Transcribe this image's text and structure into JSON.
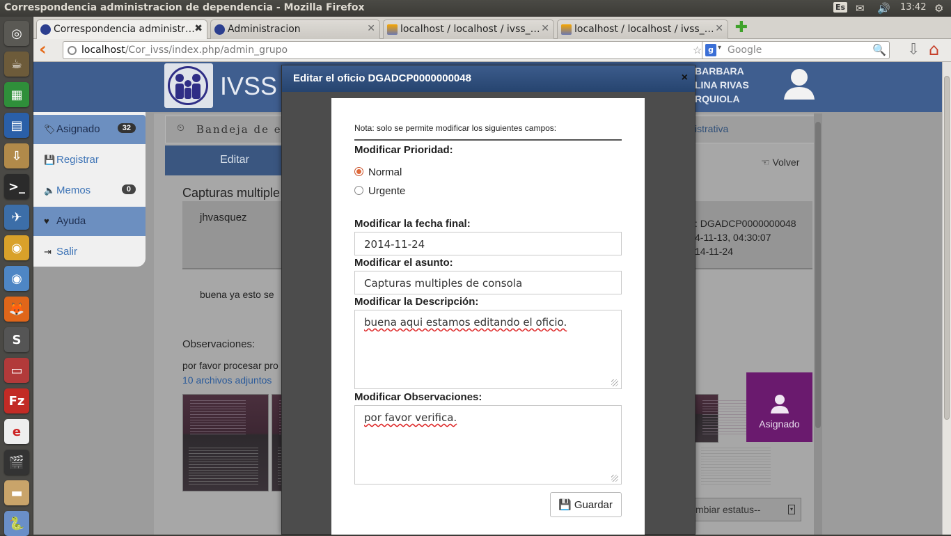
{
  "os_panel": {
    "window_title": "Correspondencia administracion de dependencia - Mozilla Firefox",
    "keyboard_layout": "Es",
    "time": "13:42"
  },
  "browser": {
    "tabs": [
      {
        "label": "Correspondencia administr…",
        "active": true
      },
      {
        "label": "Administracion",
        "active": false
      },
      {
        "label": "localhost / localhost / ivss_…",
        "active": false
      },
      {
        "label": "localhost / localhost / ivss_…",
        "active": false
      }
    ],
    "url_host": "localhost",
    "url_path": "/Cor_ivss/index.php/admin_grupo",
    "search_placeholder": "Google"
  },
  "app": {
    "logo_text": "IVSS",
    "user_name_lines": [
      "BARBARA",
      "LINA RIVAS",
      "RQUIOLA"
    ],
    "sidebar": {
      "items": [
        {
          "label": "Asignado",
          "badge": "32"
        },
        {
          "label": "Registrar"
        },
        {
          "label": "Memos",
          "badge": "0"
        },
        {
          "label": "Ayuda"
        },
        {
          "label": "Salir"
        }
      ]
    },
    "breadcrumb": "Bandeja de ent",
    "breadcrumb_right": "istrativa",
    "edit_tab": "Editar",
    "volver": "Volver",
    "subject_fragment": "Capturas multiple",
    "sender": "jhvasquez",
    "meta_lines": [
      ": DGADCP0000000048",
      "4-11-13, 04:30:07",
      "14-11-24"
    ],
    "description_fragment": "buena ya esto se",
    "observaciones_label": "Observaciones:",
    "observaciones_fragment": "por favor procesar pro",
    "attachments_link": "10 archivos adjuntos",
    "status_label": "Asignado",
    "status_select": "mbiar estatus--"
  },
  "modal": {
    "title": "Editar el oficio DGADCP0000000048",
    "note": "Nota: solo se permite modificar los siguientes campos:",
    "priority_label": "Modificar Prioridad:",
    "priority_options": [
      {
        "label": "Normal",
        "checked": true
      },
      {
        "label": "Urgente",
        "checked": false
      }
    ],
    "date_label": "Modificar la fecha final:",
    "date_value": "2014-11-24",
    "subject_label": "Modificar el asunto:",
    "subject_value": "Capturas multiples de consola",
    "description_label": "Modificar la Descripción:",
    "description_value": "buena aqui estamos editando el oficio.",
    "observations_label": "Modificar Observaciones:",
    "observations_value": "por favor verifica.",
    "save_label": "Guardar"
  },
  "colors": {
    "header_blue": "#3f5e8f",
    "status_purple": "#6a1a6e",
    "radio_accent": "#e06a3a"
  }
}
